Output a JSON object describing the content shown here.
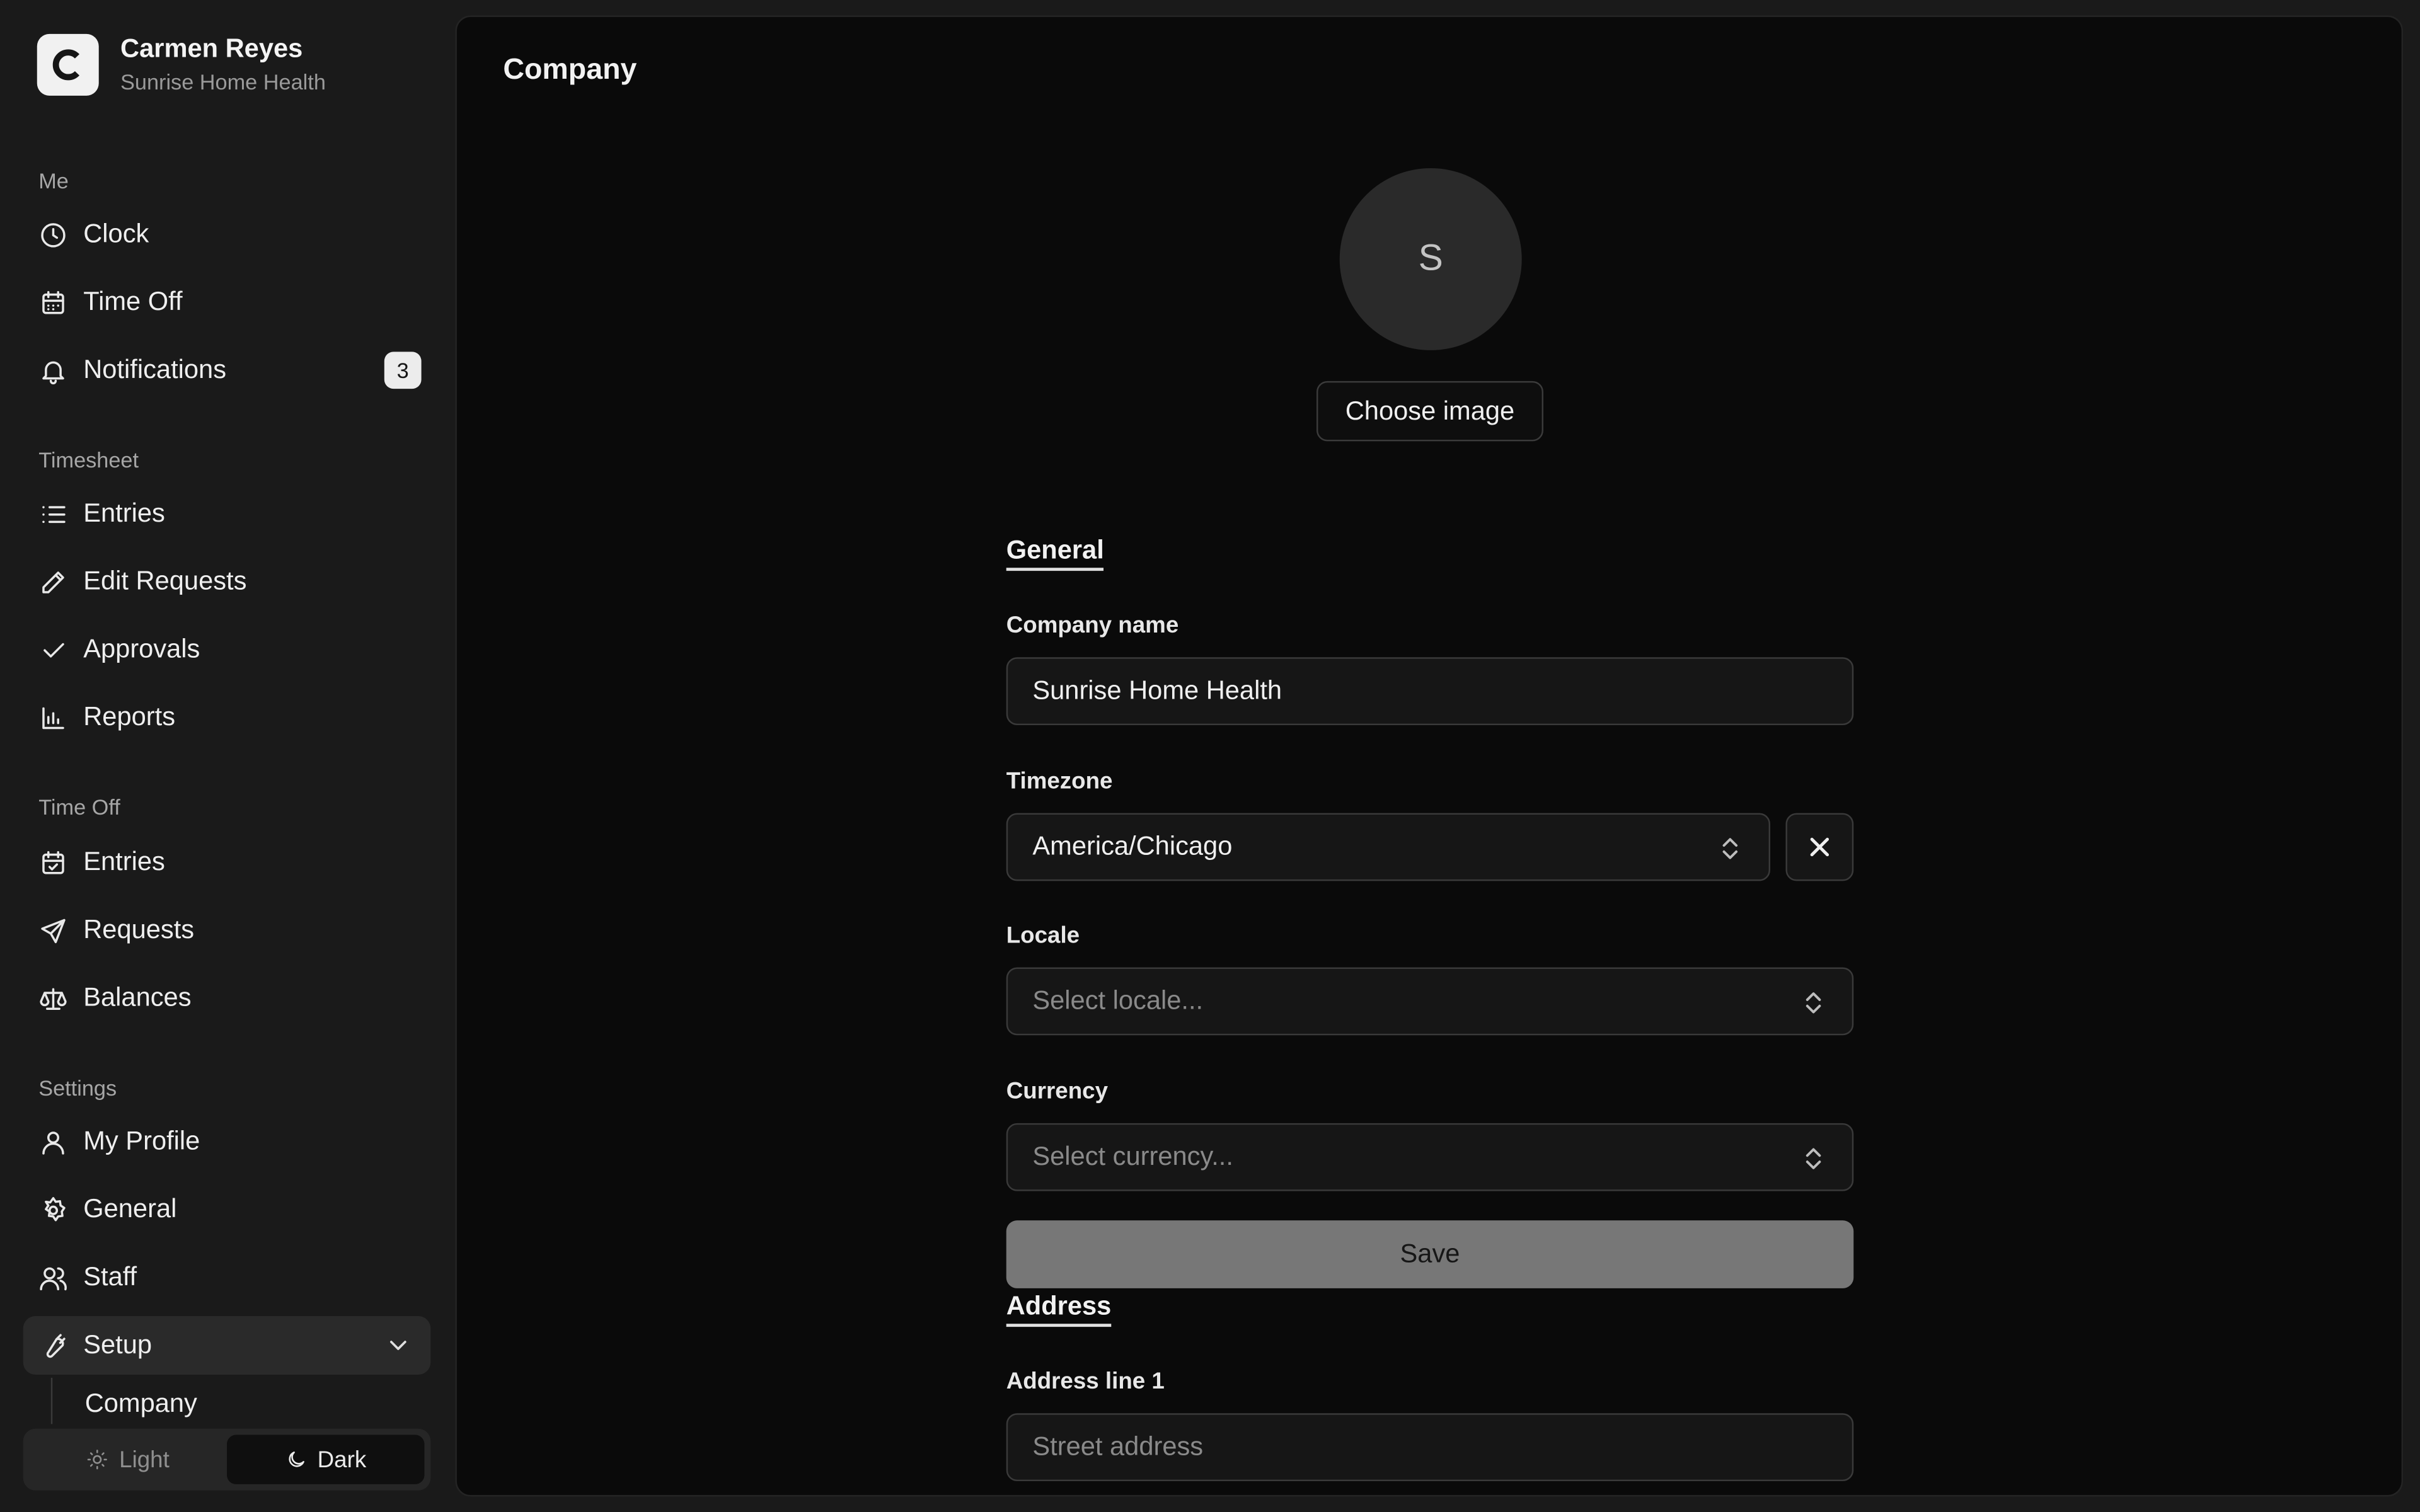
{
  "user": {
    "name": "Carmen Reyes",
    "company": "Sunrise Home Health",
    "logo_letter": "C"
  },
  "sidebar": {
    "sections": {
      "me": "Me",
      "timesheet": "Timesheet",
      "timeoff": "Time Off",
      "settings": "Settings"
    },
    "me": {
      "clock": "Clock",
      "time_off": "Time Off",
      "notifications": "Notifications",
      "notifications_count": "3"
    },
    "timesheet": {
      "entries": "Entries",
      "edit_requests": "Edit Requests",
      "approvals": "Approvals",
      "reports": "Reports"
    },
    "timeoff": {
      "entries": "Entries",
      "requests": "Requests",
      "balances": "Balances"
    },
    "settings": {
      "my_profile": "My Profile",
      "general": "General",
      "staff": "Staff",
      "setup": "Setup",
      "company": "Company"
    },
    "theme": {
      "light": "Light",
      "dark": "Dark",
      "selected": "Dark"
    }
  },
  "main": {
    "title": "Company",
    "avatar_letter": "S",
    "choose_image": "Choose image",
    "general": {
      "heading": "General",
      "company_name_label": "Company name",
      "company_name_value": "Sunrise Home Health",
      "timezone_label": "Timezone",
      "timezone_value": "America/Chicago",
      "locale_label": "Locale",
      "locale_placeholder": "Select locale...",
      "currency_label": "Currency",
      "currency_placeholder": "Select currency...",
      "save": "Save"
    },
    "address": {
      "heading": "Address",
      "line1_label": "Address line 1",
      "line1_placeholder": "Street address"
    }
  }
}
